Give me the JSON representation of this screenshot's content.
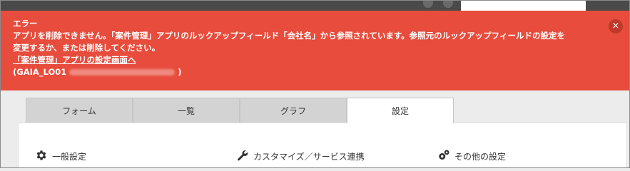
{
  "error": {
    "title": "エラー",
    "line1": "アプリを削除できません。「案件管理」アプリのルックアップフィールド「会社名」から参照されています。参照元のルックアップフィールドの設定を",
    "line2": "変更するか、または削除してください。",
    "link": "「案件管理」アプリの設定画面へ",
    "code_prefix": "(GAIA_LO01",
    "code_suffix": ")",
    "close_symbol": "×"
  },
  "tabs": [
    {
      "label": "フォーム"
    },
    {
      "label": "一覧"
    },
    {
      "label": "グラフ"
    },
    {
      "label": "設定",
      "active": true
    }
  ],
  "settings": {
    "general": "一般設定",
    "customize": "カスタマイズ／サービス連携",
    "other": "その他の設定"
  },
  "colors": {
    "banner": "#e74c3c",
    "tab_bg": "#d3d3d3",
    "active_tab_bg": "#ffffff"
  }
}
